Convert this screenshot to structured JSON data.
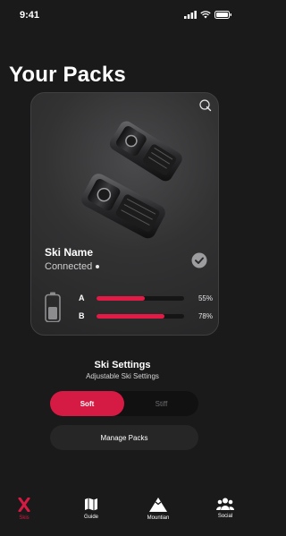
{
  "status_bar": {
    "time": "9:41"
  },
  "page": {
    "title": "Your Packs"
  },
  "pack_card": {
    "ski_name": "Ski Name",
    "status": "Connected",
    "battery_levels": [
      {
        "label": "A",
        "value_text": "55%",
        "fraction": 0.55
      },
      {
        "label": "B",
        "value_text": "78%",
        "fraction": 0.78
      }
    ]
  },
  "settings": {
    "title": "Ski Settings",
    "subtitle": "Adjustable Ski Settings",
    "options": [
      "Soft",
      "Stiff"
    ],
    "selected": "Soft",
    "manage_label": "Manage Packs"
  },
  "tab_bar": {
    "items": [
      {
        "label": "Skis",
        "icon": "x-icon",
        "active": true
      },
      {
        "label": "Guide",
        "icon": "map-icon",
        "active": false
      },
      {
        "label": "Mountian",
        "icon": "mountain-icon",
        "active": false
      },
      {
        "label": "Social",
        "icon": "people-icon",
        "active": false
      }
    ]
  },
  "colors": {
    "accent": "#d51a43",
    "background": "#1a1a1b",
    "card": "#323233"
  }
}
